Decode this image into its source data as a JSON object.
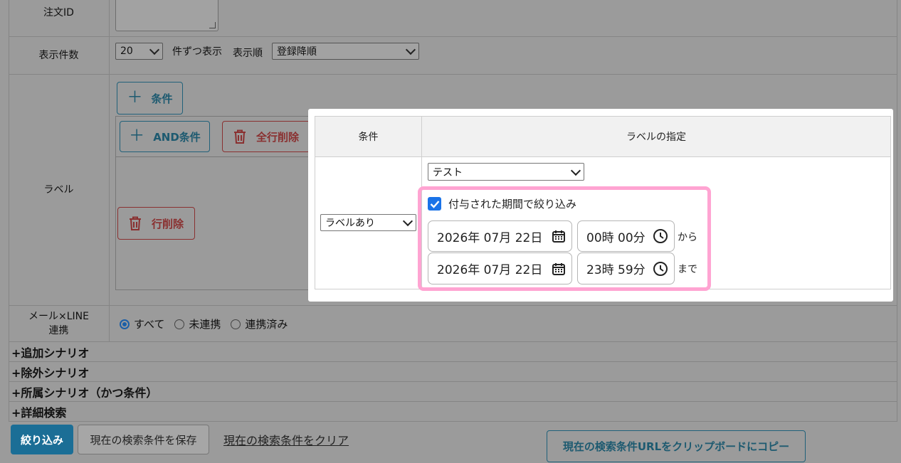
{
  "form": {
    "order_id_label": "注文ID",
    "display_count_label": "表示件数",
    "count_value": "20",
    "count_suffix": "件ずつ表示",
    "order_label": "表示順",
    "order_value": "登録降順",
    "label_row_label": "ラベル",
    "add_condition_label": "条件",
    "and_condition_label": "AND条件",
    "delete_all_label": "全行削除",
    "delete_row_label": "行削除",
    "mail_line_label_1": "メール×LINE",
    "mail_line_label_2": "連携",
    "radio_options": [
      "すべて",
      "未連携",
      "連携済み"
    ],
    "sections": [
      "+追加シナリオ",
      "+除外シナリオ",
      "+所属シナリオ（かつ条件）",
      "+詳細検索"
    ],
    "filter_button": "絞り込み",
    "save_button": "現在の検索条件を保存",
    "clear_link": "現在の検索条件をクリア",
    "copy_url_button": "現在の検索条件URLをクリップボードにコピー"
  },
  "modal": {
    "col_condition": "条件",
    "col_label_spec": "ラベルの指定",
    "condition_value": "ラベルあり",
    "label_value": "テスト",
    "checkbox_label": "付与された期間で絞り込み",
    "from_date": "2026年 07月 22日",
    "from_time": "00時 00分",
    "from_suffix": "から",
    "to_date": "2026年 07月 22日",
    "to_time": "23時 59分",
    "to_suffix": "まで"
  },
  "colors": {
    "overlay": "#9b9b9b",
    "highlight": "#ffa4d2",
    "primary": "#1b6e96",
    "danger": "#8a3030"
  }
}
